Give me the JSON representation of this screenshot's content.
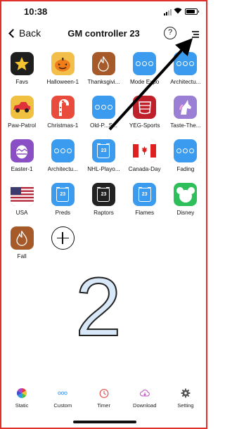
{
  "status": {
    "time": "10:38"
  },
  "header": {
    "back_label": "Back",
    "title": "GM controller 23",
    "help_glyph": "?"
  },
  "grid": [
    [
      {
        "label": "Favs",
        "icon": "star-icon",
        "color": "#1e1e1e"
      },
      {
        "label": "Halloween-1",
        "icon": "pumpkin-icon",
        "color": "#f2c04a"
      },
      {
        "label": "Thanksgivi...",
        "icon": "flame-icon",
        "color": "#a65a2a"
      },
      {
        "label": "Mode Expo",
        "icon": "dots-icon",
        "color": "#3a9bef"
      },
      {
        "label": "Architectu...",
        "icon": "dots-icon",
        "color": "#3a9bef"
      }
    ],
    [
      {
        "label": "Paw-Patrol",
        "icon": "car-icon",
        "color": "#f0c040"
      },
      {
        "label": "Christmas-1",
        "icon": "candy-cane-icon",
        "color": "#e94b3c"
      },
      {
        "label": "Old-P...S...",
        "icon": "dots-icon",
        "color": "#3a9bef"
      },
      {
        "label": "YEG-Sports",
        "icon": "hockey-icon",
        "color": "#c0202a"
      },
      {
        "label": "Taste-The...",
        "icon": "unicorn-icon",
        "color": "#9b7fd4"
      }
    ],
    [
      {
        "label": "Easter-1",
        "icon": "egg-icon",
        "color": "#8a4fc4"
      },
      {
        "label": "Architectu...",
        "icon": "dots-icon",
        "color": "#3a9bef"
      },
      {
        "label": "NHL-Playo...",
        "icon": "jersey-icon",
        "color": "#3a9bef",
        "number": "23"
      },
      {
        "label": "Canada-Day",
        "icon": "canada-flag-icon",
        "color": "#e02020"
      },
      {
        "label": "Fading",
        "icon": "dots-icon",
        "color": "#3a9bef"
      }
    ],
    [
      {
        "label": "USA",
        "icon": "usa-flag-icon",
        "color": "#b22234"
      },
      {
        "label": "Preds",
        "icon": "jersey-icon",
        "color": "#3a9bef",
        "number": "23"
      },
      {
        "label": "Raptors",
        "icon": "jersey-icon",
        "color": "#222222",
        "number": "23"
      },
      {
        "label": "Flames",
        "icon": "jersey-icon",
        "color": "#3a9bef",
        "number": "23"
      },
      {
        "label": "Disney",
        "icon": "mickey-icon",
        "color": "#2fbf5a"
      }
    ],
    [
      {
        "label": "Fall",
        "icon": "flame-icon",
        "color": "#a65a2a"
      },
      {
        "label": "",
        "icon": "add-icon",
        "color": "#ffffff"
      }
    ]
  ],
  "annotation": {
    "number": "2"
  },
  "tabs": [
    {
      "label": "Static",
      "icon": "color-wheel-icon"
    },
    {
      "label": "Custom",
      "icon": "dots-icon"
    },
    {
      "label": "Timer",
      "icon": "timer-icon"
    },
    {
      "label": "Download",
      "icon": "cloud-download-icon"
    },
    {
      "label": "Setting",
      "icon": "gear-icon"
    }
  ],
  "colors": {
    "accent_blue": "#3a9bef",
    "frame_red": "#e0302a",
    "timer_red": "#e04a4a",
    "download_pink": "#c04ac0"
  }
}
